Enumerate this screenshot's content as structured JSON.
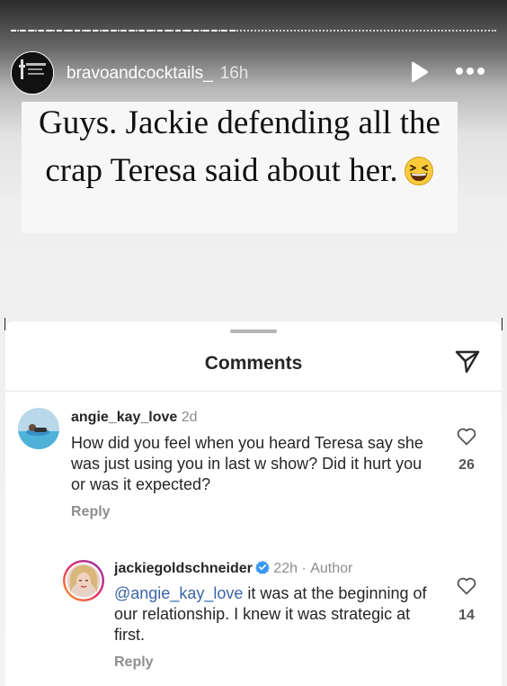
{
  "story": {
    "account_name": "bravoandcocktails_",
    "time_ago": "16h",
    "caption": "Guys. Jackie defending all the crap Teresa said about her.",
    "icons": [
      "play-icon",
      "more-icon",
      "grinning-squinting-emoji"
    ]
  },
  "comments_sheet": {
    "title": "Comments",
    "comments": [
      {
        "username": "angie_kay_love",
        "time": "2d",
        "text": "How did you feel when you heard Teresa say she was just using you in last w show? Did it hurt you or was it expected?",
        "reply_label": "Reply",
        "like_count": "26"
      },
      {
        "username": "jackiegoldschneider",
        "time": "22h",
        "separator": "·",
        "author_label": "Author",
        "mention": "@angie_kay_love",
        "text": " it was at the beginning of our relationship. I knew it was strategic at first.",
        "reply_label": "Reply",
        "like_count": "14"
      }
    ]
  },
  "colors": {
    "mention": "#3a64a8",
    "verified": "#3897f0",
    "meta": "#8e8e8e"
  }
}
